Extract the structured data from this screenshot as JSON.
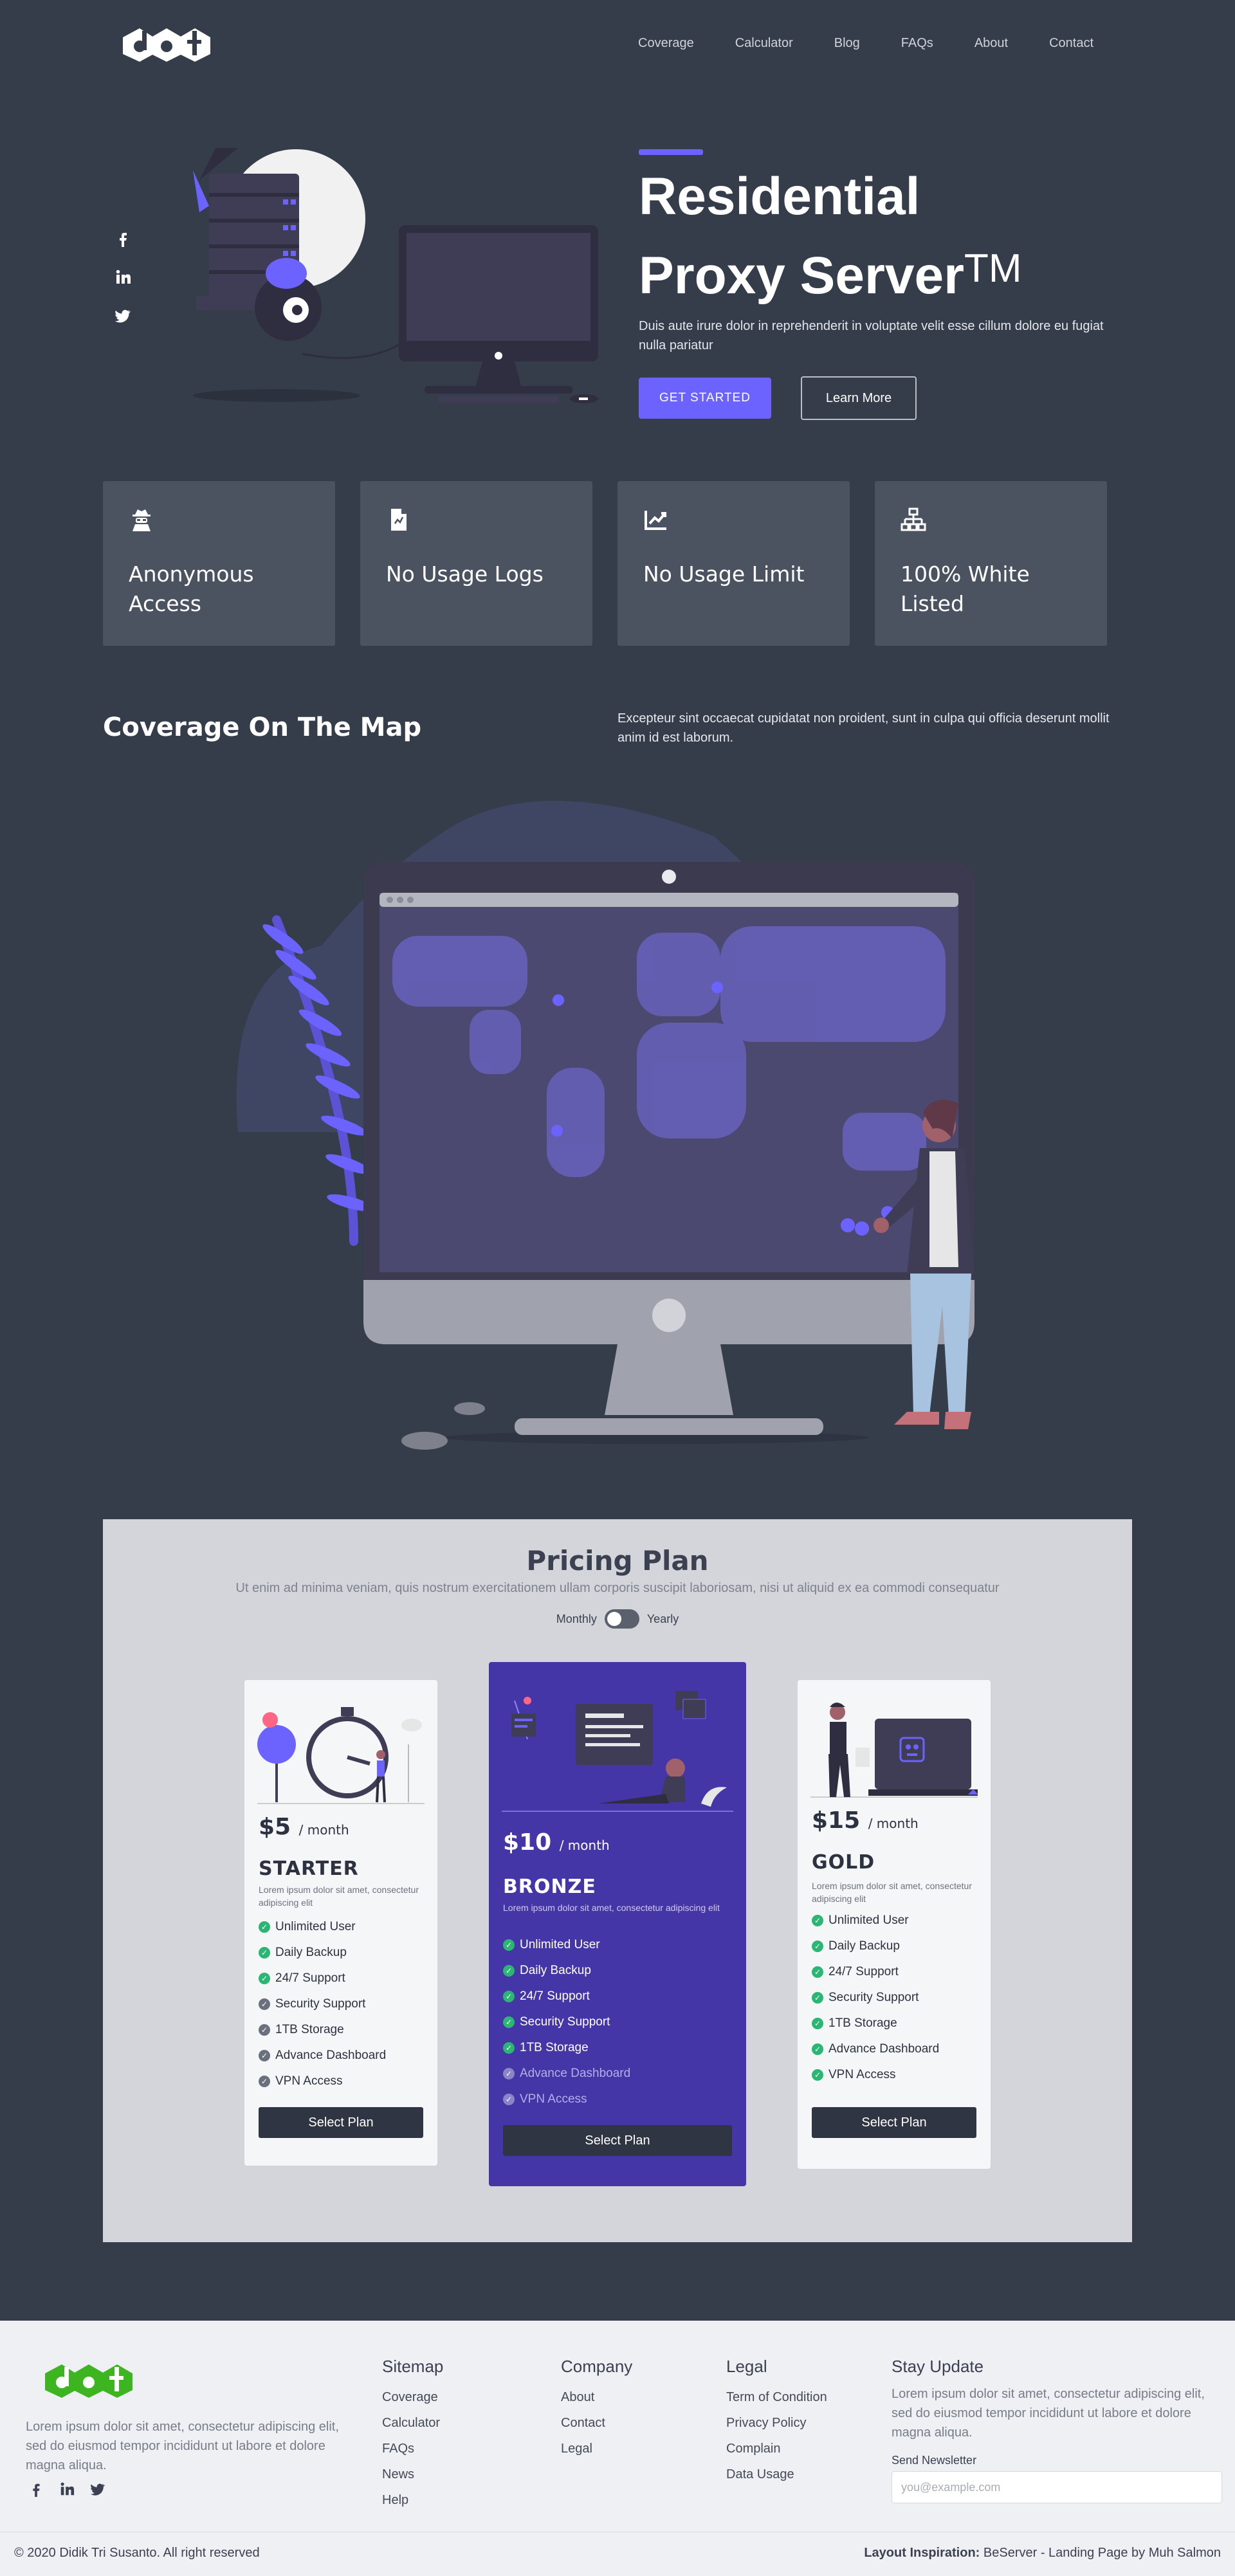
{
  "nav": {
    "logo_text": "dot",
    "links": [
      "Coverage",
      "Calculator",
      "Blog",
      "FAQs",
      "About",
      "Contact"
    ]
  },
  "social": [
    "facebook-icon",
    "linkedin-icon",
    "twitter-icon"
  ],
  "hero": {
    "title_line1": "Residential",
    "title_line2": "Proxy Server",
    "title_sup": "TM",
    "subtitle": "Duis aute irure dolor in reprehenderit in voluptate velit esse cillum dolore eu fugiat nulla pariatur",
    "cta_primary": "GET STARTED",
    "cta_secondary": "Learn More"
  },
  "features": [
    {
      "icon": "user-secret-icon",
      "label": "Anonymous Access"
    },
    {
      "icon": "file-icon",
      "label": "No Usage Logs"
    },
    {
      "icon": "chart-line-icon",
      "label": "No Usage Limit"
    },
    {
      "icon": "sitemap-icon",
      "label": "100% White Listed"
    }
  ],
  "coverage": {
    "title": "Coverage On The Map",
    "text": "Excepteur sint occaecat cupidatat non proident, sunt in culpa qui officia deserunt mollit anim id est laborum."
  },
  "pricing": {
    "title": "Pricing Plan",
    "subtitle": "Ut enim ad minima veniam, quis nostrum exercitationem ullam corporis suscipit laboriosam, nisi ut aliquid ex ea commodi consequatur",
    "toggle_left": "Monthly",
    "toggle_right": "Yearly",
    "per": "/ month",
    "select_label": "Select Plan",
    "plans": [
      {
        "price": "$5",
        "name": "STARTER",
        "desc": "Lorem ipsum dolor sit amet, consectetur adipiscing elit",
        "features": [
          "Unlimited User",
          "Daily Backup",
          "24/7 Support",
          "Security Support",
          "1TB Storage",
          "Advance Dashboard",
          "VPN Access"
        ],
        "included": [
          true,
          true,
          true,
          false,
          false,
          false,
          false
        ]
      },
      {
        "price": "$10",
        "name": "BRONZE",
        "desc": "Lorem ipsum dolor sit amet, consectetur adipiscing elit",
        "features": [
          "Unlimited User",
          "Daily Backup",
          "24/7 Support",
          "Security Support",
          "1TB Storage",
          "Advance Dashboard",
          "VPN Access"
        ],
        "included": [
          true,
          true,
          true,
          true,
          true,
          false,
          false
        ]
      },
      {
        "price": "$15",
        "name": "GOLD",
        "desc": "Lorem ipsum dolor sit amet, consectetur adipiscing elit",
        "features": [
          "Unlimited User",
          "Daily Backup",
          "24/7 Support",
          "Security Support",
          "1TB Storage",
          "Advance Dashboard",
          "VPN Access"
        ],
        "included": [
          true,
          true,
          true,
          true,
          true,
          true,
          true
        ]
      }
    ]
  },
  "footer": {
    "logo_text": "dot",
    "desc": "Lorem ipsum dolor sit amet, consectetur adipiscing elit, sed do eiusmod tempor incididunt ut labore et dolore magna aliqua.",
    "sitemap": {
      "title": "Sitemap",
      "links": [
        "Coverage",
        "Calculator",
        "FAQs",
        "News",
        "Help"
      ]
    },
    "company": {
      "title": "Company",
      "links": [
        "About",
        "Contact",
        "Legal"
      ]
    },
    "legal": {
      "title": "Legal",
      "links": [
        "Term of Condition",
        "Privacy Policy",
        "Complain",
        "Data Usage"
      ]
    },
    "stay": {
      "title": "Stay Update",
      "desc": "Lorem ipsum dolor sit amet, consectetur adipiscing elit, sed do eiusmod tempor incididunt ut labore et dolore magna aliqua.",
      "newsletter_label": "Send Newsletter",
      "placeholder": "you@example.com"
    },
    "copyright": "© 2020 Didik Tri Susanto. All right reserved",
    "inspiration_label": "Layout Inspiration:",
    "inspiration_text": "BeServer - Landing Page by Muh Salmon"
  },
  "colors": {
    "background": "#353d4a",
    "accent": "#6c63ff",
    "card": "#4b5260",
    "highlight_plan": "#4536a8",
    "check_included": "#2bb673",
    "check_excluded": "#6b717c",
    "logo_green": "#3cb521"
  }
}
